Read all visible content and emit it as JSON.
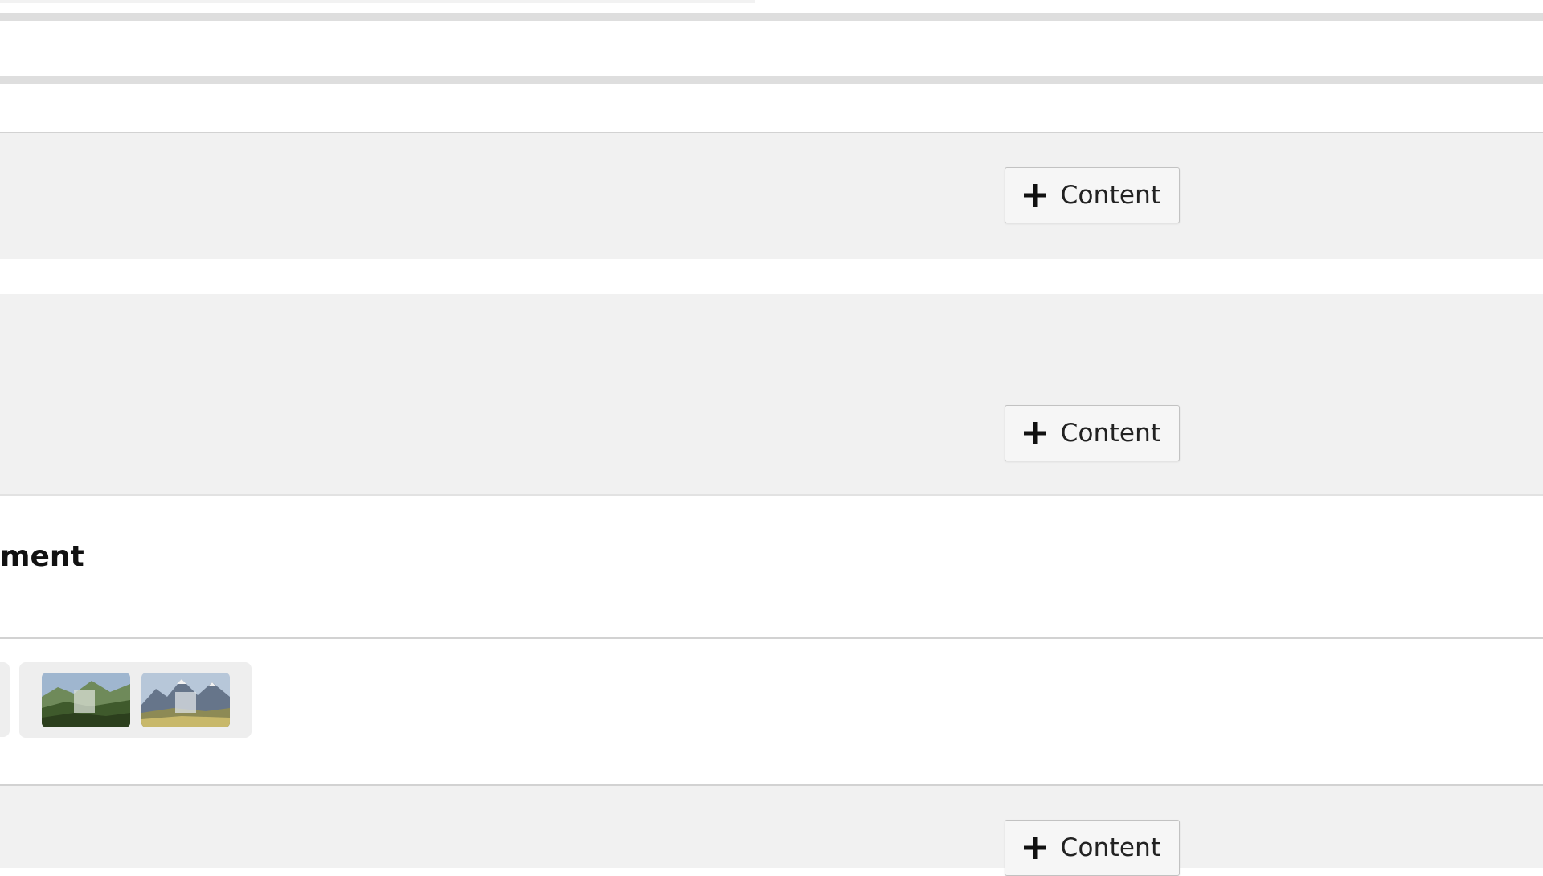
{
  "sections": [
    {
      "add_content_label": "Content",
      "add_icon": "plus-icon"
    },
    {
      "add_content_label": "Content",
      "add_icon": "plus-icon"
    },
    {
      "add_content_label": "Content",
      "add_icon": "plus-icon"
    }
  ],
  "element": {
    "title_fragment": "ment",
    "thumbnails": [
      {
        "icon": "landscape-green-icon"
      },
      {
        "icon": "landscape-mountain-icon"
      }
    ]
  },
  "colors": {
    "band_gray": "#f1f1f1",
    "divider": "#d2d2d2",
    "button_border": "#c2c2c2"
  }
}
